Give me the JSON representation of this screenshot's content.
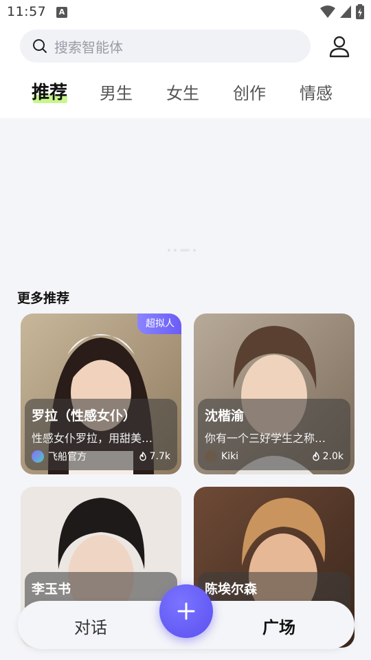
{
  "status_bar": {
    "time": "11:57",
    "a_icon": "A"
  },
  "header": {
    "search_placeholder": "搜索智能体"
  },
  "tabs": [
    {
      "label": "推荐",
      "active": true
    },
    {
      "label": "男生",
      "active": false
    },
    {
      "label": "女生",
      "active": false
    },
    {
      "label": "创作",
      "active": false
    },
    {
      "label": "情感",
      "active": false
    }
  ],
  "section": {
    "title": "更多推荐"
  },
  "cards": [
    {
      "name": "罗拉（性感女仆）",
      "desc": "性感女仆罗拉，用甜美…",
      "author": "飞船官方",
      "count": "7.7k",
      "badge": "超拟人"
    },
    {
      "name": "沈楷渝",
      "desc": "你有一个三好学生之称…",
      "author": "Kiki",
      "count": "2.0k",
      "badge": ""
    },
    {
      "name": "李玉书",
      "desc": "",
      "author": "",
      "count": "",
      "badge": ""
    },
    {
      "name": "陈埃尔森",
      "desc": "",
      "author": "",
      "count": "",
      "badge": ""
    }
  ],
  "bottom_nav": {
    "chat": "对话",
    "square": "广场"
  },
  "colors": {
    "accent": "#5b4ff0",
    "tab_highlight": "#c8f58e",
    "badge": "#7a70f8"
  }
}
